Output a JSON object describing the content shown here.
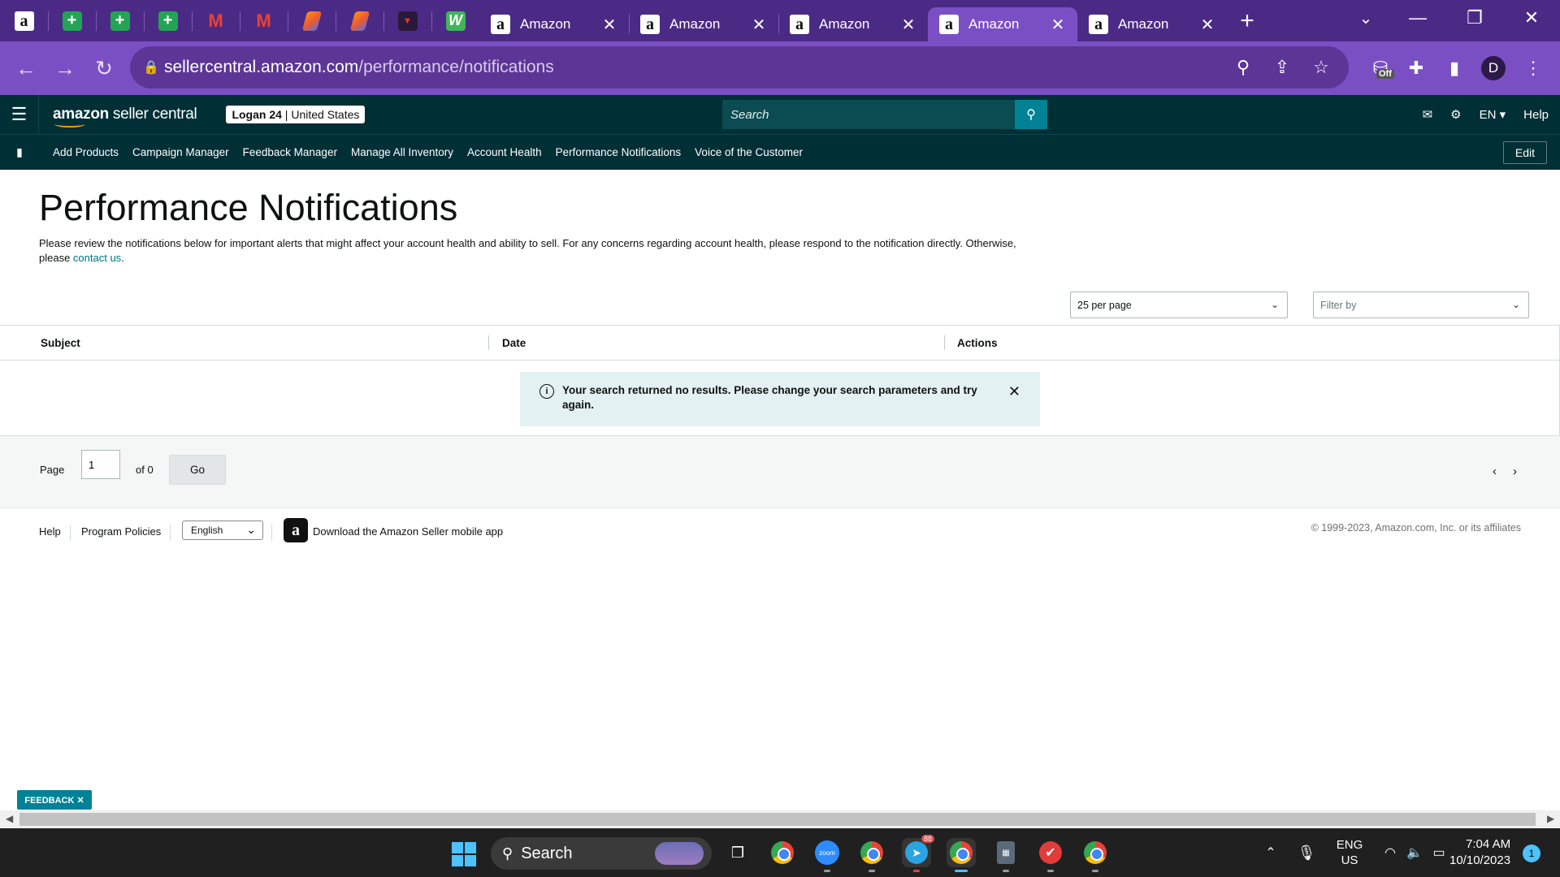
{
  "browser": {
    "pinned_tabs": [
      {
        "icon": "amazon-icon",
        "glyph": "a"
      },
      {
        "icon": "sheets-icon",
        "glyph": "+"
      },
      {
        "icon": "sheets-icon",
        "glyph": "+"
      },
      {
        "icon": "sheets-icon",
        "glyph": "+"
      },
      {
        "icon": "gmail-icon",
        "glyph": "M"
      },
      {
        "icon": "gmail-icon",
        "glyph": "M"
      },
      {
        "icon": "app-slash-icon",
        "glyph": ""
      },
      {
        "icon": "app-slash-icon",
        "glyph": ""
      },
      {
        "icon": "red-logo-icon",
        "glyph": "▼"
      },
      {
        "icon": "w-app-icon",
        "glyph": "W"
      }
    ],
    "tabs": [
      {
        "title": "Amazon",
        "active": false
      },
      {
        "title": "Amazon",
        "active": false
      },
      {
        "title": "Amazon",
        "active": false
      },
      {
        "title": "Amazon",
        "active": true
      },
      {
        "title": "Amazon",
        "active": false
      }
    ],
    "url_host": "sellercentral.amazon.com",
    "url_path": "/performance/notifications",
    "extension_badge": "Off",
    "profile_initial": "D"
  },
  "header": {
    "logo_bold": "amazon",
    "logo_rest": " seller central",
    "account_name": "Logan 24",
    "account_region": " | United States",
    "search_placeholder": "Search",
    "language": "EN ▾",
    "help": "Help"
  },
  "nav": {
    "links": [
      "Add Products",
      "Campaign Manager",
      "Feedback Manager",
      "Manage All Inventory",
      "Account Health",
      "Performance Notifications",
      "Voice of the Customer"
    ],
    "edit_label": "Edit"
  },
  "page": {
    "title": "Performance Notifications",
    "intro": "Please review the notifications below for important alerts that might affect your account health and ability to sell. For any concerns regarding account health, please respond to the notification directly. Otherwise, please ",
    "contact_link": "contact us",
    "intro_end": ".",
    "per_page": "25 per page",
    "filter_placeholder": "Filter by"
  },
  "table": {
    "columns": [
      "Subject",
      "Date",
      "Actions"
    ],
    "empty_message": "Your search returned no results. Please change your search parameters and try again."
  },
  "pager": {
    "page_label": "Page",
    "current_page": "1",
    "of_label": "of 0",
    "go_label": "Go"
  },
  "footer": {
    "help": "Help",
    "policies": "Program Policies",
    "language": "English",
    "app_text": "Download the Amazon Seller mobile app",
    "copyright": "© 1999-2023, Amazon.com, Inc. or its affiliates"
  },
  "feedback_label": "FEEDBACK ✕",
  "taskbar": {
    "search": "Search",
    "telegram_badge": "88",
    "lang_top": "ENG",
    "lang_bottom": "US",
    "time": "7:04 AM",
    "date": "10/10/2023",
    "notification_count": "1"
  },
  "colors": {
    "chrome_tabstrip": "#4b2a86",
    "chrome_toolbar": "#7b4fc4",
    "sc_header": "#002f36",
    "accent_teal": "#008296",
    "alert_bg": "#e3f1f2"
  }
}
